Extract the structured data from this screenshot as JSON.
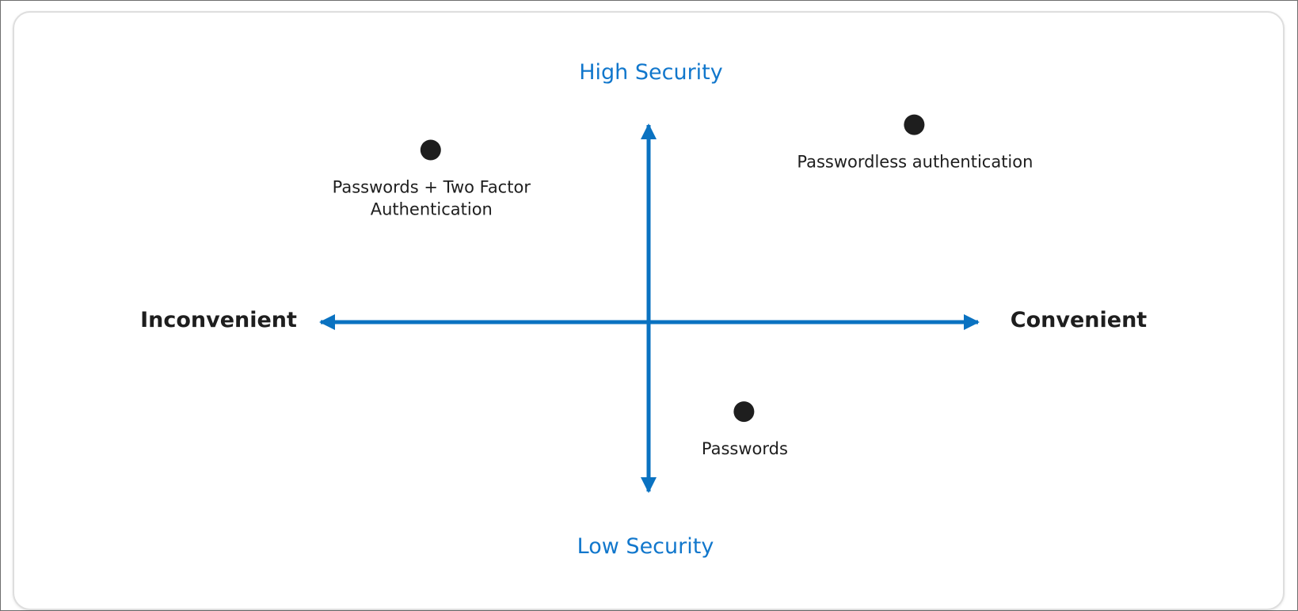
{
  "colors": {
    "axis": "#0a72c1",
    "accent_text": "#1177cc",
    "dark_text": "#1e1e1e",
    "point": "#1e1e1e"
  },
  "axes": {
    "top_label": "High Security",
    "bottom_label": "Low Security",
    "left_label": "Inconvenient",
    "right_label": "Convenient"
  },
  "items": [
    {
      "id": "passwords-2fa",
      "label_lines": [
        "Passwords + Two Factor",
        "Authentication"
      ],
      "convenience": -0.64,
      "security": 0.75
    },
    {
      "id": "passwordless",
      "label_lines": [
        "Passwordless authentication"
      ],
      "convenience": 0.78,
      "security": 0.86
    },
    {
      "id": "passwords",
      "label_lines": [
        "Passwords"
      ],
      "convenience": 0.28,
      "security": -0.39
    }
  ]
}
